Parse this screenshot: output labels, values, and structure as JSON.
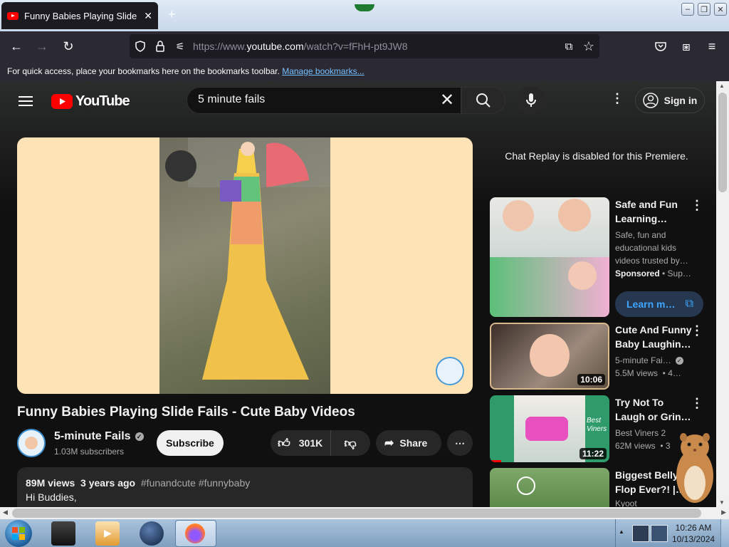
{
  "browser": {
    "tab_title": "Funny Babies Playing Slide Fails",
    "url_prefix": "https://www.",
    "url_domain": "youtube.com",
    "url_path": "/watch?v=fFhH-pt9JW8",
    "bookmarks_prompt": "For quick access, place your bookmarks here on the bookmarks toolbar.",
    "manage_bookmarks": "Manage bookmarks..."
  },
  "youtube": {
    "logo_text": "YouTube",
    "search_value": "5 minute fails",
    "sign_in": "Sign in",
    "video_title": "Funny Babies Playing Slide Fails - Cute Baby Videos",
    "channel_name": "5-minute Fails",
    "subscribers": "1.03M subscribers",
    "subscribe": "Subscribe",
    "likes": "301K",
    "share": "Share",
    "views": "89M views",
    "age": "3 years ago",
    "hashtags": "#funandcute #funnybaby",
    "description_line": "Hi Buddies,",
    "chat_replay": "Chat Replay is disabled for this Premiere."
  },
  "recommendations": [
    {
      "title1": "Safe and Fun",
      "title2": "Learning…",
      "desc1": "Safe, fun and",
      "desc2": "educational kids",
      "desc3": "videos trusted by…",
      "sponsored": "Sponsored",
      "sponsor_suffix": "• Sup…",
      "cta": "Learn m…"
    },
    {
      "title1": "Cute And Funny",
      "title2": "Baby Laughin…",
      "channel": "5-minute Fai…",
      "stats": "5.5M views  • 4…",
      "duration": "10:06"
    },
    {
      "title1": "Try Not To",
      "title2": "Laugh or Grin…",
      "channel": "Best Viners 2",
      "stats": "62M views  • 3",
      "duration": "11:22",
      "thumb_text1": "Best",
      "thumb_text2": "Viners"
    },
    {
      "title1": "Biggest Belly",
      "title2": "Flop Ever?! |…",
      "channel": "Kyoot"
    }
  ],
  "taskbar": {
    "time": "10:26 AM",
    "date": "10/13/2024"
  },
  "colors": {
    "yt_red": "#ff0000",
    "link_blue": "#3ea6ff",
    "background": "#0f0f0f"
  }
}
